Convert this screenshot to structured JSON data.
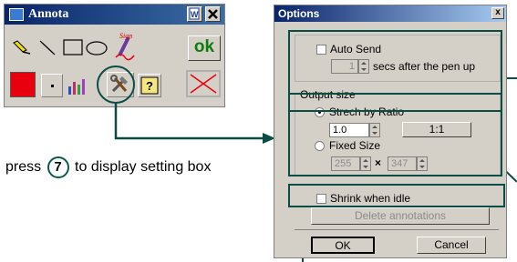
{
  "annota_window": {
    "title": "Annota",
    "ok_label": "ok",
    "tools": [
      "highlighter-icon",
      "line-icon",
      "rectangle-icon",
      "ellipse-icon",
      "signature-icon",
      "ok-button",
      "red-color",
      "dot-size",
      "chart-icon",
      "settings-icon",
      "help-icon",
      "clear-icon"
    ],
    "colors": {
      "red": "#e8000e",
      "teal": "#0b4d44",
      "ok_green": "#107c10"
    },
    "signature_text": "Sign"
  },
  "callout": {
    "text_before": "press",
    "step_number": "7",
    "text_after": "to display setting box"
  },
  "options_dialog": {
    "title": "Options",
    "close_label": "x",
    "auto_send": {
      "label": "Auto Send",
      "checked": false,
      "value": "1",
      "suffix": "secs after the pen up"
    },
    "output_size": {
      "group_label": "Output size",
      "stretch_label": "Strech by Ratio",
      "stretch_selected": true,
      "ratio_value": "1.0",
      "ratio_button": "1:1",
      "fixed_label": "Fixed Size",
      "fixed_width": "255",
      "times": "×",
      "fixed_height": "347"
    },
    "shrink": {
      "label": "Shrink when idle",
      "checked": false
    },
    "delete_label": "Delete annotations",
    "ok_label": "OK",
    "cancel_label": "Cancel"
  }
}
